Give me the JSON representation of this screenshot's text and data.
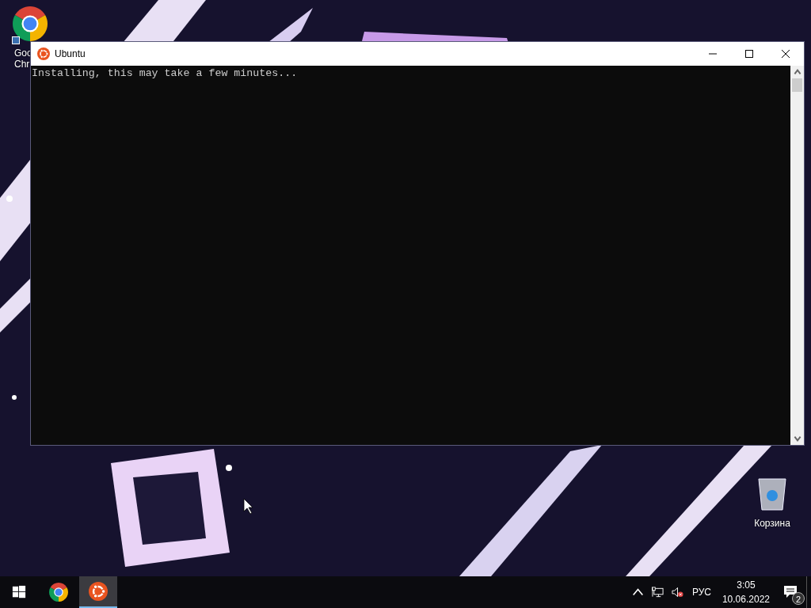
{
  "desktop": {
    "icons": [
      {
        "kind": "chrome",
        "label_lines": [
          "Goo",
          "Chr"
        ]
      },
      {
        "kind": "recycle_bin",
        "label_lines": [
          "Корзина"
        ]
      }
    ]
  },
  "window": {
    "title": "Ubuntu",
    "console_lines": [
      "Installing, this may take a few minutes..."
    ]
  },
  "taskbar": {
    "apps": [
      {
        "kind": "start",
        "selected": false
      },
      {
        "kind": "chrome",
        "selected": false
      },
      {
        "kind": "ubuntu",
        "selected": true
      }
    ],
    "tray": {
      "language": "РУС",
      "time": "3:05",
      "date": "10.06.2022",
      "notifications": "2"
    }
  }
}
